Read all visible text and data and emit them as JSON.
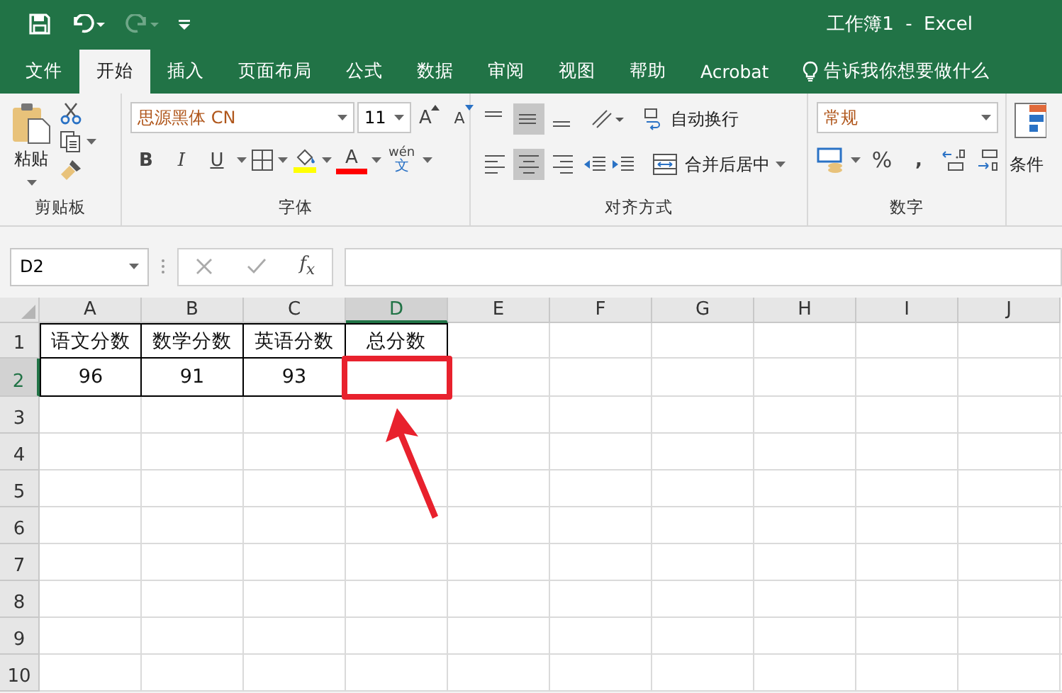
{
  "window": {
    "title": "工作簿1  -  Excel"
  },
  "tabs": [
    {
      "label": "文件",
      "selected": false
    },
    {
      "label": "开始",
      "selected": true
    },
    {
      "label": "插入",
      "selected": false
    },
    {
      "label": "页面布局",
      "selected": false
    },
    {
      "label": "公式",
      "selected": false
    },
    {
      "label": "数据",
      "selected": false
    },
    {
      "label": "审阅",
      "selected": false
    },
    {
      "label": "视图",
      "selected": false
    },
    {
      "label": "帮助",
      "selected": false
    },
    {
      "label": "Acrobat",
      "selected": false
    }
  ],
  "tell_me": "告诉我你想要做什么",
  "ribbon": {
    "clipboard": {
      "paste": "粘贴",
      "label": "剪贴板"
    },
    "font": {
      "name": "思源黑体 CN",
      "size": "11",
      "grow": "A",
      "shrink": "A",
      "bold": "B",
      "italic": "I",
      "underline": "U",
      "color_letter": "A",
      "phonetic_top": "wén",
      "phonetic_bottom": "文",
      "label": "字体"
    },
    "alignment": {
      "vertical": [
        {
          "selected": false
        },
        {
          "selected": true
        },
        {
          "selected": false
        }
      ],
      "horizontal": [
        {
          "selected": false
        },
        {
          "selected": true
        },
        {
          "selected": false
        }
      ],
      "wrap": "自动换行",
      "merge": "合并后居中",
      "label": "对齐方式"
    },
    "number": {
      "format": "常规",
      "percent": "%",
      "comma": ",",
      "label": "数字"
    },
    "styles": {
      "conditional": "条件"
    }
  },
  "formula_bar": {
    "name_box": "D2",
    "fx": "f$_{x}$"
  },
  "sheet": {
    "columns": [
      {
        "label": "A",
        "selected": false
      },
      {
        "label": "B",
        "selected": false
      },
      {
        "label": "C",
        "selected": false
      },
      {
        "label": "D",
        "selected": true
      },
      {
        "label": "E",
        "selected": false
      },
      {
        "label": "F",
        "selected": false
      },
      {
        "label": "G",
        "selected": false
      },
      {
        "label": "H",
        "selected": false
      },
      {
        "label": "I",
        "selected": false
      },
      {
        "label": "J",
        "selected": false
      }
    ],
    "rows": [
      {
        "label": "1",
        "selected": false,
        "cells": [
          "语文分数",
          "数学分数",
          "英语分数",
          "总分数"
        ]
      },
      {
        "label": "2",
        "selected": true,
        "cells": [
          "96",
          "91",
          "93"
        ]
      },
      {
        "label": "3",
        "selected": false
      },
      {
        "label": "4",
        "selected": false
      },
      {
        "label": "5",
        "selected": false
      },
      {
        "label": "6",
        "selected": false
      },
      {
        "label": "7",
        "selected": false
      },
      {
        "label": "8",
        "selected": false
      },
      {
        "label": "9",
        "selected": false
      },
      {
        "label": "10",
        "selected": false
      }
    ]
  }
}
